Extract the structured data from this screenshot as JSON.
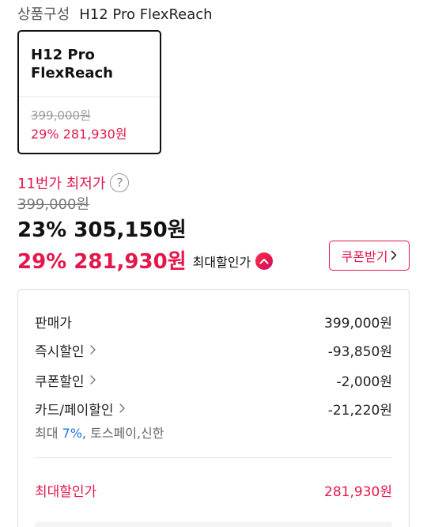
{
  "composition": {
    "label": "상품구성",
    "value": "H12 Pro FlexReach"
  },
  "option_card": {
    "name": "H12 Pro FlexReach",
    "original_price": "399,000원",
    "sale_price": "29% 281,930원"
  },
  "pricing": {
    "lowest_label": "11번가 최저가",
    "help_symbol": "?",
    "original_price": "399,000원",
    "price": "23% 305,150원",
    "max_discount_price": "29% 281,930원",
    "max_discount_label": "최대할인가"
  },
  "coupon_button": {
    "label": "쿠폰받기"
  },
  "breakdown": {
    "rows": [
      {
        "label": "판매가",
        "value": "399,000원"
      },
      {
        "label": "즉시할인",
        "value": "-93,850원"
      },
      {
        "label": "쿠폰할인",
        "value": "-2,000원"
      },
      {
        "label": "카드/페이할인",
        "value": "-21,220원"
      }
    ],
    "card_sub": {
      "prefix": "최대 ",
      "accent": "7%",
      "suffix": ", 토스페이,신한"
    },
    "total_label": "최대할인가",
    "total_value": "281,930원"
  },
  "colors": {
    "accent": "#e4174a",
    "link_blue": "#1a73e8"
  },
  "icons": {
    "help": "question-circle-icon",
    "discount_badge": "chevron-up-badge-icon",
    "coupon": "chevron-right-icon",
    "detail": "chevron-right-icon"
  }
}
